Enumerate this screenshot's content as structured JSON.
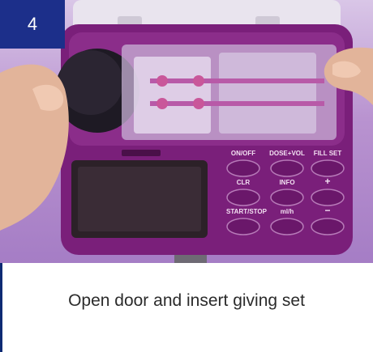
{
  "step": {
    "number": "4"
  },
  "caption": "Open door and insert giving set",
  "device": {
    "buttons": [
      {
        "label": "ON/OFF"
      },
      {
        "label": "DOSE+VOL"
      },
      {
        "label": "FILL SET"
      },
      {
        "label": "CLR"
      },
      {
        "label": "INFO"
      },
      {
        "label": "+"
      },
      {
        "label": "START/STOP"
      },
      {
        "label": "ml/h"
      },
      {
        "label": "−"
      }
    ]
  },
  "colors": {
    "badge": "#1c2f8a",
    "device_purple": "#7a1f7a",
    "accent_rule": "#0d2a73"
  }
}
